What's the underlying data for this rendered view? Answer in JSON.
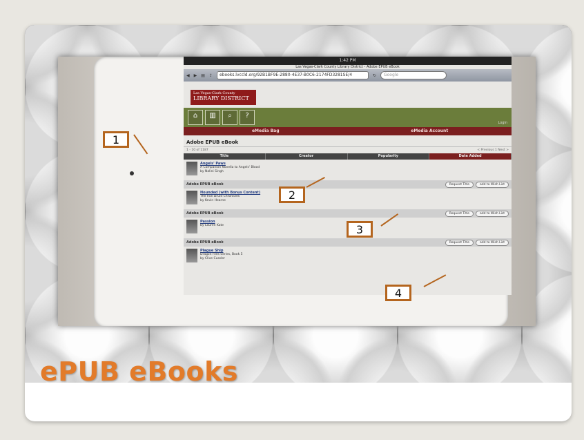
{
  "slide": {
    "title": "ePUB eBooks"
  },
  "callouts": [
    "1",
    "2",
    "3",
    "4"
  ],
  "browser": {
    "status_time": "1:42 PM",
    "page_title": "Las Vegas-Clark County Library District - Adobe EPUB eBook",
    "url": "ebooks.lvccld.org/92B1BF9E-2880-4E37-B0C6-2174FD3281SE/4",
    "search_placeholder": "Google"
  },
  "site": {
    "logo_small": "Las Vegas-Clark County",
    "logo_big": "LIBRARY DISTRICT",
    "nav_icons": [
      "home-icon",
      "book-icon",
      "search-icon",
      "help-icon"
    ],
    "login": "Login",
    "tabs": [
      "eMedia Bag",
      "eMedia Account"
    ],
    "heading": "Adobe EPUB eBook",
    "pager_left": "1 - 10 of 1187",
    "pager_right": "< Previous 1 Next >",
    "columns": [
      "Title",
      "Creator",
      "Popularity",
      "Date Added"
    ],
    "request_label": "Request Title",
    "wishlist_label": "add to Wish List",
    "books": [
      {
        "title": "Angels' Paws",
        "subtitle": "A Companion Novella to Angels' Blood",
        "author": "by Nalini Singh",
        "format": "Adobe EPUB eBook"
      },
      {
        "title": "Hounded (with Bonus Content)",
        "subtitle": "The Iron Druid Chronicles",
        "author": "by Kevin Hearne",
        "format": "Adobe EPUB eBook"
      },
      {
        "title": "Passion",
        "subtitle": "",
        "author": "by Lauren Kate",
        "format": "Adobe EPUB eBook"
      },
      {
        "title": "Plague Ship",
        "subtitle": "Dragon Files Series, Book 5",
        "author": "by Clive Cussler",
        "format": ""
      }
    ]
  },
  "colors": {
    "accent": "#e27b2a",
    "callout_border": "#b4651e",
    "site_red": "#7b1f1f",
    "site_green": "#6b7d3b"
  }
}
